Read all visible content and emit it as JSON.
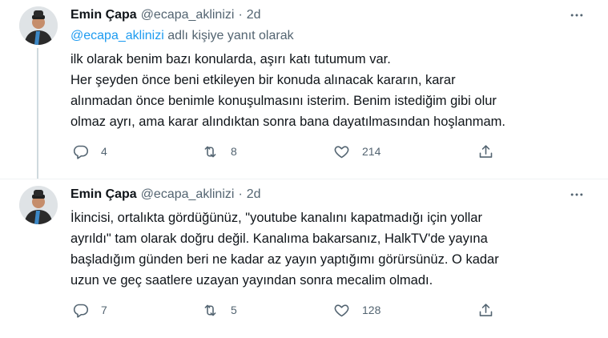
{
  "tweets": [
    {
      "author": {
        "name": "Emin Çapa",
        "handle": "@ecapa_aklinizi",
        "time": "2d"
      },
      "reply_prefix_link": "@ecapa_aklinizi",
      "reply_suffix": " adlı kişiye yanıt olarak",
      "lines": [
        "ilk olarak benim bazı konularda, aşırı katı tutumum var.",
        "Her şeyden önce beni etkileyen bir konuda alınacak kararın, karar",
        "alınmadan önce benimle konuşulmasını isterim. Benim istediğim gibi olur",
        "olmaz ayrı, ama karar alındıktan sonra bana dayatılmasından hoşlanmam."
      ],
      "actions": {
        "replies": "4",
        "retweets": "8",
        "likes": "214"
      }
    },
    {
      "author": {
        "name": "Emin Çapa",
        "handle": "@ecapa_aklinizi",
        "time": "2d"
      },
      "lines": [
        "İkincisi, ortalıkta gördüğünüz, \"youtube kanalını kapatmadığı için yollar",
        "ayrıldı\" tam olarak doğru değil. Kanalıma bakarsanız, HalkTV'de yayına",
        "başladığım günden beri ne kadar az yayın yaptığımı görürsünüz. O kadar",
        "uzun ve geç saatlere uzayan yayından sonra mecalim olmadı."
      ],
      "actions": {
        "replies": "7",
        "retweets": "5",
        "likes": "128"
      }
    }
  ],
  "separator": "·",
  "icons": [
    "more-icon",
    "reply-icon",
    "retweet-icon",
    "like-icon",
    "share-icon"
  ],
  "colors": {
    "link": "#1d9bf0",
    "secondary": "#536471",
    "text": "#0f1419"
  }
}
